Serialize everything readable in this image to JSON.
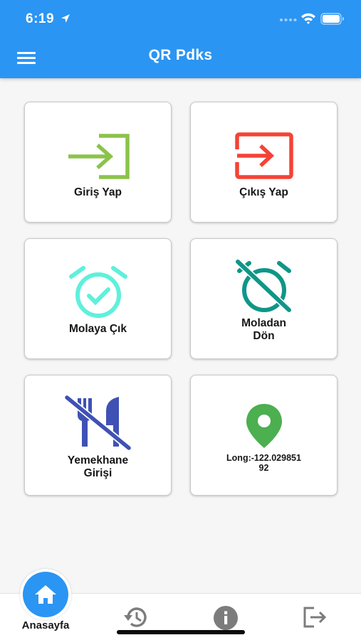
{
  "status_bar": {
    "time": "6:19"
  },
  "header": {
    "title": "QR Pdks",
    "menu_icon": "hamburger-menu-icon"
  },
  "cards": [
    {
      "label": "Giriş Yap",
      "icon": "login-arrow-icon",
      "icon_color": "#8bc34a"
    },
    {
      "label": "Çıkış Yap",
      "icon": "exit-to-app-icon",
      "icon_color": "#f44336"
    },
    {
      "label": "Molaya Çık",
      "icon": "alarm-on-icon",
      "icon_color": "#5ff0dc"
    },
    {
      "label_lines": [
        "Moladan",
        "Dön"
      ],
      "icon": "alarm-off-icon",
      "icon_color": "#0f9688"
    },
    {
      "label_lines": [
        "Yemekhane",
        "Girişi"
      ],
      "icon": "no-meals-icon",
      "icon_color": "#3f51b5"
    },
    {
      "label_lines": [
        "Long:-122.029851",
        "92"
      ],
      "icon": "location-pin-icon",
      "icon_color": "#4caf50"
    }
  ],
  "bottom_nav": {
    "home_label": "Anasayfa",
    "items": [
      {
        "icon": "home-icon"
      },
      {
        "icon": "history-icon"
      },
      {
        "icon": "info-icon"
      },
      {
        "icon": "logout-icon"
      }
    ]
  },
  "colors": {
    "primary": "#2b95f3",
    "background": "#f6f6f6",
    "nav_icon": "#7c7c7c"
  }
}
